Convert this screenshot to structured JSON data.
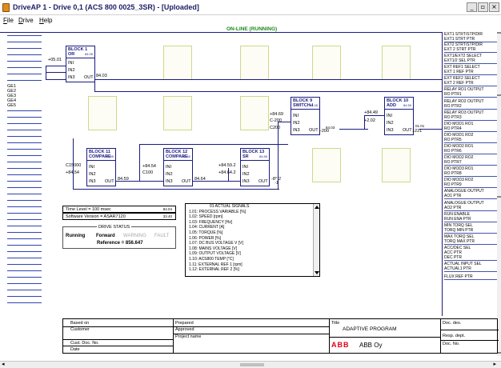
{
  "window": {
    "title": "DriveAP 1 - Drive 0,1 (ACS 800 0025_3SR) - [Uploaded]"
  },
  "controls": {
    "minimize": "_",
    "restore": "▫",
    "close": "×"
  },
  "menu": [
    {
      "label": "File",
      "u": "F",
      "rest": "ile"
    },
    {
      "label": "Drive",
      "u": "D",
      "rest": "rive"
    },
    {
      "label": "Help",
      "u": "H",
      "rest": "elp"
    }
  ],
  "status": "ON-LINE (RUNNING)",
  "left_rail": {
    "labels": [
      "GE1",
      "GE2",
      "GE3",
      "GE4",
      "GE5"
    ]
  },
  "blocks": [
    {
      "title": "BLOCK 1",
      "type": "OR",
      "num": "84.05",
      "pins": [
        "INI",
        "IN2",
        "IN3"
      ],
      "out": "OUT"
    },
    {
      "title": "BLOCK 9",
      "type": "SWITCH-I",
      "num": "84.45",
      "pins": [
        "INI",
        "IN2",
        "IN3"
      ],
      "out": "OUT"
    },
    {
      "title": "BLOCK 10",
      "type": "ADD",
      "num": "84.50",
      "pins": [
        "INI",
        "IN2",
        "IN3"
      ],
      "out": "OUT"
    },
    {
      "title": "BLOCK 11",
      "type": "COMPARE",
      "num": "84.55",
      "pins": [
        "INI",
        "IN2",
        "IN3"
      ],
      "out": "OUT"
    },
    {
      "title": "BLOCK 12",
      "type": "COMPARE",
      "num": "84.60",
      "pins": [
        "INI",
        "IN2",
        "IN3"
      ],
      "out": "OUT"
    },
    {
      "title": "BLOCK 13",
      "type": "SR",
      "num": "84.65",
      "pins": [
        "INI",
        "IN2",
        "IN3"
      ],
      "out": "OUT"
    }
  ],
  "wire_labels": {
    "b1_in1": "+05.01",
    "b1_out": "84.03",
    "b9_in1": "+84.69",
    "b9_in2": "C-200",
    "b9_in3": "C200",
    "b9_out": "84.03",
    "b9_out2": "-200",
    "b10_in1": "+84.49",
    "b10_in2": "+2.02",
    "b10_out": "01.01",
    "b10_out2": "1221",
    "b11_in1": "C15000",
    "b11_in2": "+84.54",
    "b11_out": "84.59",
    "b12_in1": "+84.54",
    "b12_in2": "C100",
    "b12_out": "84.64",
    "b13_in1": "+84.59.2",
    "b13_in2": "+84.64.2",
    "b13_out": "-8^.2",
    "b13_out2": "-1"
  },
  "info": {
    "time_level_label": "Time Level = 100 msec",
    "time_level_val": "84.04",
    "sw_label": "Software Version = ASAR7120",
    "sw_val": "33.40",
    "drive_status_title": "DRIVE STATUS",
    "running": "Running",
    "forward": "Forward",
    "warning": "WARNING",
    "fault": "FAULT",
    "reference": "Reference = 856.647"
  },
  "signals": {
    "header": "01 ACTUAL SIGNALS",
    "items": [
      "1.01: PROCESS VARIABLE [%]",
      "1.02: SPEED [rpm]",
      "1.03: FREQUENCY [Hz]",
      "1.04: CURRENT [A]",
      "1.05: TORQUE [%]",
      "1.06: POWER [%]",
      "1.07: DC BUS VOLTAGE V [V]",
      "1.08: MAINS VOLTAGE [V]",
      "1.09: OUTPUT VOLTAGE [V]",
      "1.10: ACS800 TEMP [°C]",
      "1.11: EXTERNAL REF 1 [rpm]",
      "1.12: EXTERNAL REF 2 [%]"
    ]
  },
  "right_panel": [
    [
      "EXT1 STRT/STP/DIR",
      "EXT1 STRT PTR"
    ],
    [
      "EXT2 STRT/STP/DIR",
      "EXT 2 STRT PTR"
    ],
    [
      "EXT1/EXT2 SELECT",
      "EXT1/2 SEL PTR"
    ],
    [
      "EXT REF1 SELECT",
      "EXT 1 REF PTR"
    ],
    [
      "EXT REF2 SELECT",
      "EXT 2 REF PTR"
    ],
    [
      "RELAY RO1 OUTPUT",
      "RO PTR1"
    ],
    [
      "RELAY RO2 OUTPUT",
      "RO PTR2"
    ],
    [
      "RELAY RO3 OUTPUT",
      "RO PTR3"
    ],
    [
      "DIO MOD1 RO1",
      "RO PTR4"
    ],
    [
      "DIO MOD1 RO2",
      "RO PTR5"
    ],
    [
      "DIO MOD2 RO1",
      "RO PTR6"
    ],
    [
      "DIO MOD2 RO2",
      "RO PTR7"
    ],
    [
      "DIO MOD3 RO1",
      "RO PTR8"
    ],
    [
      "DIO MOD3 RO2",
      "RO PTR9"
    ],
    [
      "ANALOGUE OUTPUT",
      "AO1 PTR"
    ],
    [
      "ANALOGUE OUTPUT",
      "AO2 PTR"
    ],
    [
      "RUN ENABLE",
      "RUN ENA PTR"
    ],
    [
      "MIN TORQ SEL",
      "TORQ MIN PTR"
    ],
    [
      "MAX TORQ SEL",
      "TORQ MAX PTR"
    ],
    [
      "ACC/DEC SEL",
      "ACC PTR",
      "DEC PTR"
    ],
    [
      "ACTUAL INPUT SEL",
      "ACTUAL1 PTR"
    ],
    [
      "FLUX REF PTR"
    ]
  ],
  "footer": {
    "based_on": "Based on",
    "customer": "Customer",
    "cust_doc": "Cust. Doc. No.",
    "date": "Date",
    "prepared": "Prepared",
    "approved": "Approved",
    "project": "Project name",
    "title_label": "Title",
    "title_val": "ADAPTIVE PROGRAM",
    "company": "ABB Oy",
    "logo": "ABB",
    "doc_des": "Doc. des.",
    "resp": "Resp. dept.",
    "doc_no": "Doc. No."
  },
  "scroll": {
    "left_arrow": "◂",
    "right_arrow": "▸"
  }
}
